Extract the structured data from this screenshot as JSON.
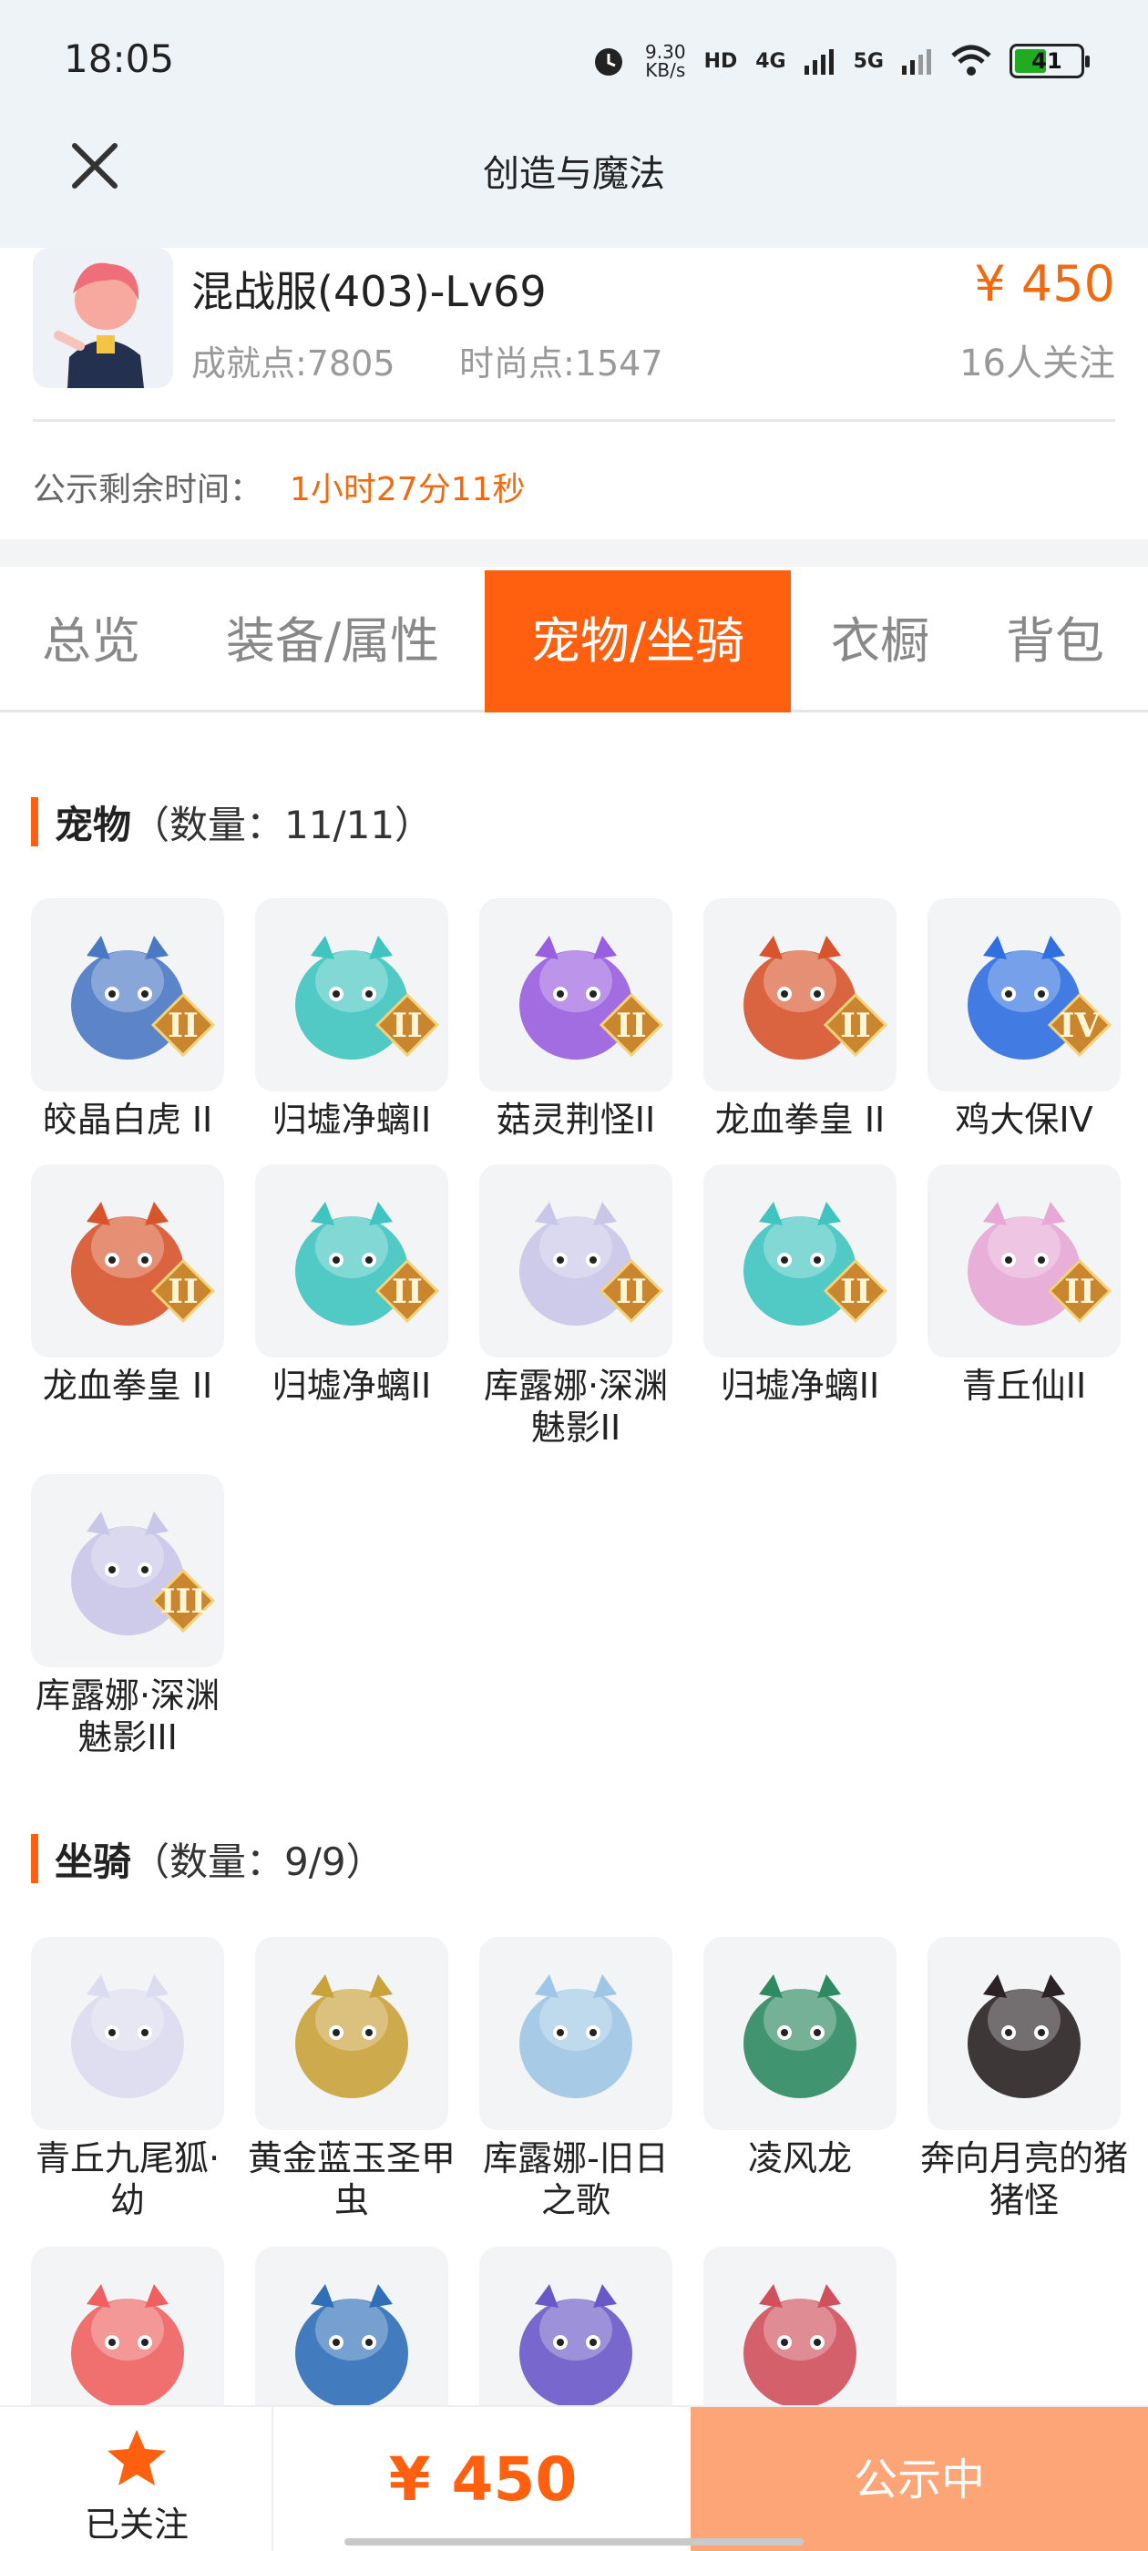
{
  "status_bar": {
    "time": "18:05",
    "net_speed_value": "9.30",
    "net_speed_unit": "KB/s",
    "hd_label": "HD",
    "sig1_label": "4G",
    "sig2_label": "5G",
    "battery": "41"
  },
  "header": {
    "title": "创造与魔法",
    "close_icon": "close-icon"
  },
  "account": {
    "name": "混战服(403)-Lv69",
    "achievement": "成就点:7805",
    "fashion": "时尚点:1547",
    "price": "¥ 450",
    "followers": "16人关注",
    "timer_label": "公示剩余时间：",
    "timer_value": "1小时27分11秒"
  },
  "tabs": [
    {
      "label": "总览"
    },
    {
      "label": "装备/属性"
    },
    {
      "label": "宠物/坐骑",
      "active": true
    },
    {
      "label": "衣橱"
    },
    {
      "label": "背包"
    }
  ],
  "pets": {
    "title": "宠物",
    "count": "（数量：11/11）",
    "items": [
      {
        "name": "皎晶白虎 II",
        "rank": "II",
        "theme": "#4a78c4",
        "icon": "tiger-icon"
      },
      {
        "name": "归墟净螭II",
        "rank": "II",
        "theme": "#3fc4c0",
        "icon": "dragon-icon"
      },
      {
        "name": "菇灵荆怪II",
        "rank": "II",
        "theme": "#9a5ee0",
        "icon": "mushroom-sprite-icon"
      },
      {
        "name": "龙血拳皇 II",
        "rank": "II",
        "theme": "#d8542c",
        "icon": "ram-beast-icon"
      },
      {
        "name": "鸡大保IV",
        "rank": "IV",
        "theme": "#2f6fe0",
        "icon": "bird-icon"
      },
      {
        "name": "龙血拳皇 II",
        "rank": "II",
        "theme": "#d8542c",
        "icon": "ram-beast-icon"
      },
      {
        "name": "归墟净螭II",
        "rank": "II",
        "theme": "#3fc4c0",
        "icon": "dragon-icon"
      },
      {
        "name": "库露娜·深渊魅影II",
        "rank": "II",
        "theme": "#c9c7e8",
        "icon": "ghost-girl-icon"
      },
      {
        "name": "归墟净螭II",
        "rank": "II",
        "theme": "#3fc4c0",
        "icon": "dragon-icon"
      },
      {
        "name": "青丘仙II",
        "rank": "II",
        "theme": "#e7a8d6",
        "icon": "fox-fairy-icon"
      },
      {
        "name": "库露娜·深渊魅影III",
        "rank": "III",
        "theme": "#c9c7e8",
        "icon": "ghost-girl-icon"
      }
    ]
  },
  "mounts": {
    "title": "坐骑",
    "count": "（数量：9/9）",
    "items": [
      {
        "name": "青丘九尾狐·幼",
        "theme": "#dcdcf0",
        "icon": "nine-tail-fox-icon"
      },
      {
        "name": "黄金蓝玉圣甲虫",
        "theme": "#c9a23a",
        "icon": "scarab-icon"
      },
      {
        "name": "库露娜-旧日之歌",
        "theme": "#9ec6e6",
        "icon": "cloud-girl-icon"
      },
      {
        "name": "凌风龙",
        "theme": "#2e8a62",
        "icon": "wind-dragon-icon"
      },
      {
        "name": "奔向月亮的猪猪怪",
        "theme": "#2a2224",
        "icon": "pig-icon"
      },
      {
        "name": "",
        "theme": "#f06060",
        "icon": "red-panda-icon"
      },
      {
        "name": "",
        "theme": "#2f6fb8",
        "icon": "blue-dragon-icon"
      },
      {
        "name": "",
        "theme": "#6a58c8",
        "icon": "owl-icon"
      },
      {
        "name": "",
        "theme": "#d0505c",
        "icon": "red-lizard-icon"
      }
    ]
  },
  "bottom_bar": {
    "follow_label": "已关注",
    "price": "¥ 450",
    "status_button": "公示中",
    "accent": "#ff6010"
  }
}
